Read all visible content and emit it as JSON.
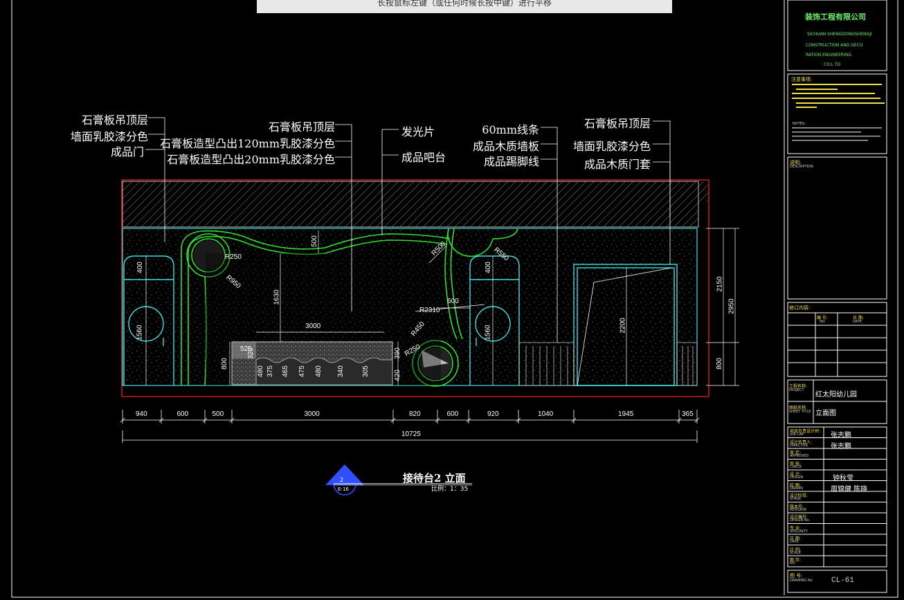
{
  "hint_bar": {
    "text": "长按鼠标左键（或任何时候长按中键）进行平移"
  },
  "labels_left": [
    "石膏板吊顶层",
    "墙面乳胶漆分色",
    "成品门"
  ],
  "labels_mid_left": [
    "石膏板吊顶层",
    "石膏板造型凸出120mm乳胶漆分色",
    "石膏板造型凸出20mm乳胶漆分色"
  ],
  "labels_mid": [
    "发光片",
    "成品吧台"
  ],
  "labels_mid_right": [
    "60mm线条",
    "成品木质墙板",
    "成品踢脚线"
  ],
  "labels_right": [
    "石膏板吊顶层",
    "墙面乳胶漆分色",
    "成品木质门套"
  ],
  "inner_dims": {
    "r250a": "R250",
    "r950": "R950",
    "r500": "R500",
    "r550": "R550",
    "r2310": "R2310",
    "r450": "R450",
    "r250b": "R250",
    "d500": "500",
    "d1630": "1630",
    "d3000": "3000",
    "d600": "600",
    "d400a": "400",
    "d1560a": "1560",
    "d400b": "400",
    "d1560b": "1560",
    "d800": "800",
    "d2200": "2200",
    "d525": "525",
    "d320": "320",
    "d390": "390",
    "d420": "420",
    "bar_heights": [
      "480",
      "375",
      "465",
      "475",
      "480",
      "340",
      "305"
    ]
  },
  "right_dims": [
    "2150",
    "2950",
    "800"
  ],
  "bottom_dims": [
    "940",
    "600",
    "500",
    "3000",
    "820",
    "600",
    "920",
    "1040",
    "1945",
    "365"
  ],
  "total_dim": "10725",
  "drawing_title": "接待台2 立面",
  "scale": "比例：1：35",
  "symbol": {
    "top": "2",
    "bottom": "E-16"
  },
  "title_block": {
    "company_top": "装饰工程有限公司",
    "company_en": [
      "SICHUAN SHENGDONGSHENGJI",
      "CONSTRUCTION AND DECO",
      "RATION ENGINEERING",
      "CO.L TD"
    ],
    "notes_title": "注意事项:",
    "notes_en_title": "NOTES:",
    "desc_title": "说明:",
    "desc_en": "DESCRIPTION",
    "rev_title": "修订内容:",
    "rev_no": "编 号:",
    "rev_date": "日 期:",
    "rev_no_en": "NO.",
    "rev_date_en": "DATE",
    "project_label": "工程名称:",
    "project_label_en": "PROJECT",
    "project_value": "红太阳幼儿园",
    "sheet_label": "图纸名称:",
    "sheet_label_en": "SHEET TITLE",
    "sheet_value": "立面图",
    "rows": [
      {
        "label": "项目负责设计师:",
        "en": "JOB CAP",
        "value": "张志鹏"
      },
      {
        "label": "设计负责人:",
        "en": "DIRECTOR",
        "value": "张志鹏"
      },
      {
        "label": "审 定:",
        "en": "APPROVED",
        "value": ""
      },
      {
        "label": "审 核:",
        "en": "CHECK",
        "value": ""
      },
      {
        "label": "设 计:",
        "en": "DESIGN",
        "value": "钟秋莹"
      },
      {
        "label": "绘 图:",
        "en": "DRAWN",
        "value": "周锦健 陈晓"
      },
      {
        "label": "设计阶段:",
        "en": "STAGE",
        "value": ""
      },
      {
        "label": "版本号:",
        "en": "REVISION",
        "value": ""
      },
      {
        "label": "设计编号:",
        "en": "DESIGN No.",
        "value": ""
      },
      {
        "label": "专 业:",
        "en": "SPECIALTY",
        "value": ""
      },
      {
        "label": "日 期:",
        "en": "DATE",
        "value": ""
      },
      {
        "label": "比 例:",
        "en": "SCALE",
        "value": ""
      },
      {
        "label": "图 页:",
        "en": "NO",
        "value": ""
      }
    ],
    "drawing_no_label": "图 号:",
    "drawing_no_en": "DRAWING No",
    "drawing_no": "CL-61"
  },
  "colors": {
    "frame": "#ff2020",
    "wall": "#40e0e0",
    "feature": "#30e030",
    "text": "#ffffff",
    "dim_line": "#ffffff"
  }
}
